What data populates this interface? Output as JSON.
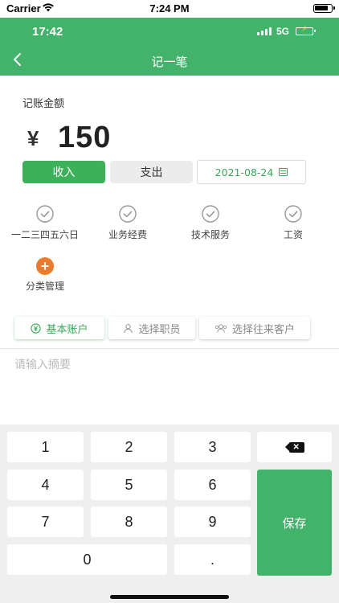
{
  "ios_status": {
    "carrier": "Carrier",
    "time": "7:24 PM"
  },
  "app_status": {
    "time": "17:42",
    "network": "5G"
  },
  "header": {
    "title": "记一笔"
  },
  "amount": {
    "label": "记账金额",
    "currency": "¥",
    "value": "150"
  },
  "type_toggle": {
    "income": "收入",
    "expense": "支出",
    "selected": "income"
  },
  "date": {
    "value": "2021-08-24"
  },
  "categories": [
    {
      "label": "一二三四五六日",
      "icon": "check-circle-icon"
    },
    {
      "label": "业务经费",
      "icon": "check-circle-icon"
    },
    {
      "label": "技术服务",
      "icon": "check-circle-icon"
    },
    {
      "label": "工资",
      "icon": "check-circle-icon"
    },
    {
      "label": "分类管理",
      "icon": "plus-circle-icon"
    }
  ],
  "selectors": {
    "account": "基本账户",
    "staff": "选择职员",
    "client": "选择往来客户"
  },
  "memo": {
    "placeholder": "请输入摘要",
    "value": ""
  },
  "keypad": {
    "keys": [
      "1",
      "2",
      "3",
      "4",
      "5",
      "6",
      "7",
      "8",
      "9",
      "0",
      "."
    ],
    "save": "保存",
    "delete_icon": "backspace-icon"
  },
  "colors": {
    "brand_green": "#43b36c",
    "income_green": "#3cb15a",
    "accent_orange": "#ee7a2b"
  }
}
